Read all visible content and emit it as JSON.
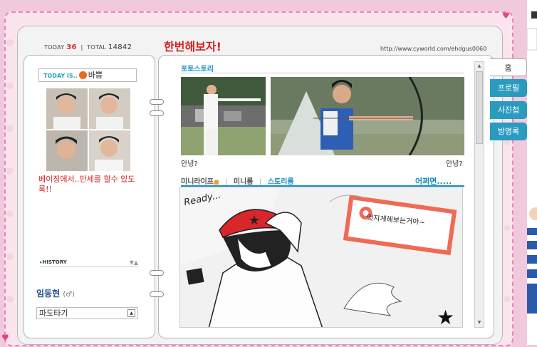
{
  "header": {
    "today_label": "TODAY",
    "today_count": "36",
    "total_label": "TOTAL",
    "total_count": "14842",
    "title": "한번해보자!",
    "url": "http://www.cyworld.com/ehdgus0060"
  },
  "profile": {
    "today_is_label": "TODAY IS..",
    "mood": "바쁨",
    "status_message": "베이징에서..만세를 할수 있도록!!",
    "history_label": "HISTORY",
    "name": "임동현",
    "gender_symbol": "(♂)",
    "dropdown_value": "파도타기"
  },
  "main": {
    "section_title": "포토스토리",
    "photo_captions": [
      "안녕?",
      "안녕?"
    ],
    "tabs": [
      {
        "label": "미니라이프",
        "active": false
      },
      {
        "label": "미니룸",
        "active": false
      },
      {
        "label": "스토리룸",
        "active": true
      }
    ],
    "more_link": "어쩌면.....",
    "speech_bubble": "멋지게해보는거야~",
    "ready_text": "Ready..."
  },
  "side_menu": [
    {
      "label": "홈",
      "active": true
    },
    {
      "label": "프로필",
      "active": false
    },
    {
      "label": "사진첩",
      "active": false
    },
    {
      "label": "방명록",
      "active": false
    }
  ],
  "colors": {
    "accent_blue": "#1b8fc2",
    "title_red": "#d62020",
    "menu_teal": "#2a9bbf",
    "background_pink": "#fbe4ee"
  }
}
